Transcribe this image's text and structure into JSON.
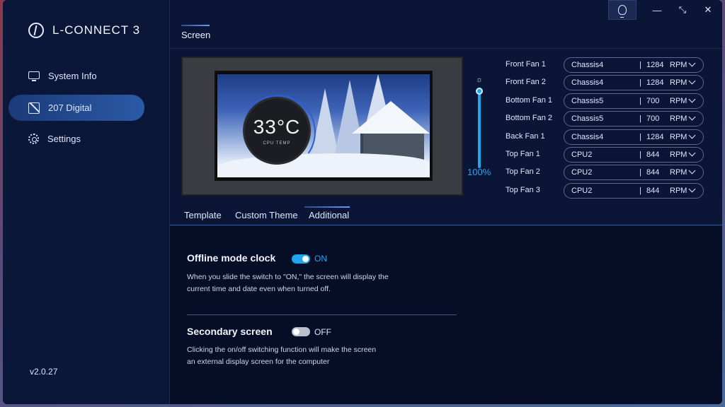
{
  "app": {
    "title": "L-CONNECT 3",
    "version": "v2.0.27"
  },
  "sidebar": {
    "items": [
      {
        "label": "System Info",
        "icon": "monitor-icon"
      },
      {
        "label": "207 Digital",
        "icon": "screen-icon",
        "active": true
      },
      {
        "label": "Settings",
        "icon": "gear-icon"
      }
    ]
  },
  "titlebar": {
    "minimize": "—",
    "restore": "⤡",
    "close": "✕"
  },
  "header": {
    "tab": "Screen"
  },
  "preview": {
    "temperature": "33°C",
    "label": "CPU TEMP"
  },
  "brightness": {
    "value": "100%",
    "level": 1.0
  },
  "fans": [
    {
      "label": "Front Fan 1",
      "source": "Chassis4",
      "sep": "|",
      "rpm": "1284",
      "unit": "RPM"
    },
    {
      "label": "Front Fan 2",
      "source": "Chassis4",
      "sep": "|",
      "rpm": "1284",
      "unit": "RPM"
    },
    {
      "label": "Bottom Fan 1",
      "source": "Chassis5",
      "sep": "|",
      "rpm": "700",
      "unit": "RPM"
    },
    {
      "label": "Bottom Fan 2",
      "source": "Chassis5",
      "sep": "|",
      "rpm": "700",
      "unit": "RPM"
    },
    {
      "label": "Back Fan 1",
      "source": "Chassis4",
      "sep": "|",
      "rpm": "1284",
      "unit": "RPM"
    },
    {
      "label": "Top Fan 1",
      "source": "CPU2",
      "sep": "|",
      "rpm": "844",
      "unit": "RPM"
    },
    {
      "label": "Top Fan 2",
      "source": "CPU2",
      "sep": "|",
      "rpm": "844",
      "unit": "RPM"
    },
    {
      "label": "Top Fan 3",
      "source": "CPU2",
      "sep": "|",
      "rpm": "844",
      "unit": "RPM"
    }
  ],
  "subtabs": [
    "Template",
    "Custom Theme",
    "Additional"
  ],
  "options": {
    "offline": {
      "title": "Offline mode clock",
      "state": "ON",
      "desc1": "When you slide the switch to \"ON,\" the screen will display the",
      "desc2": "current time and date even when turned off."
    },
    "secondary": {
      "title": "Secondary screen",
      "state": "OFF",
      "desc1": "Clicking the on/off switching function will make the screen",
      "desc2": "an external display screen for the computer"
    }
  },
  "colors": {
    "accent": "#1fa7ee",
    "bg": "#0b1637",
    "panel": "#060d27"
  }
}
